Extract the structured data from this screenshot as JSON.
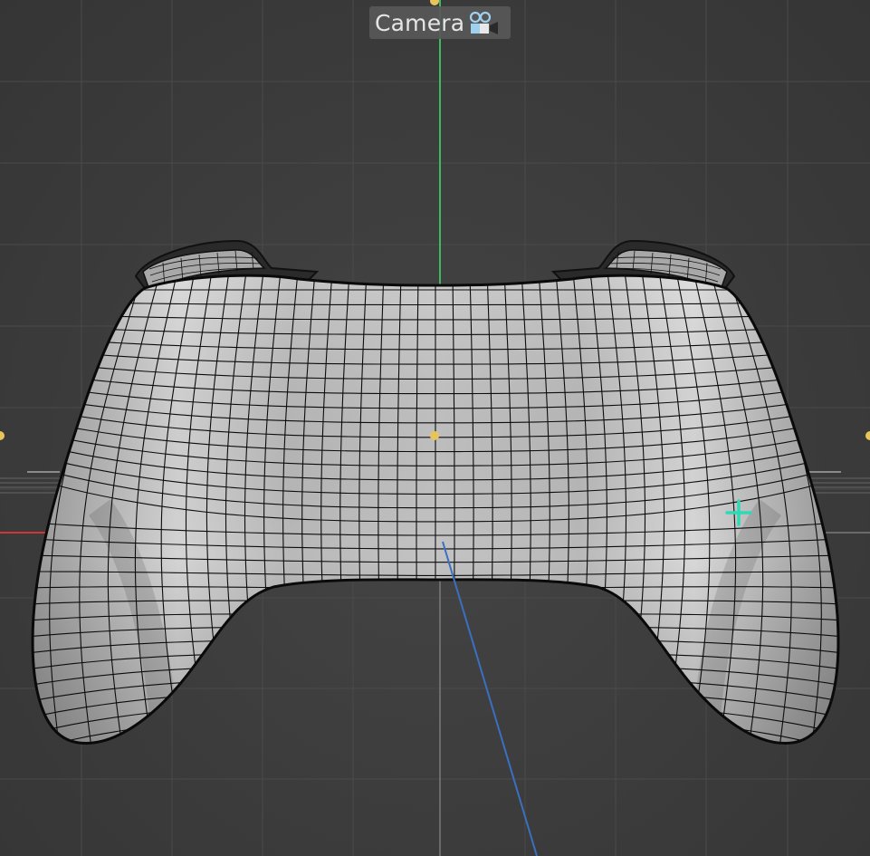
{
  "viewport": {
    "camera_label": "Camera",
    "camera_icon": "camera-icon",
    "object_name": "gamepad-mesh",
    "axis_colors": {
      "x": "#d0353a",
      "y": "#3fb862",
      "z": "#3b6fc2"
    },
    "accent_colors": {
      "handle": "#e8c55a",
      "cursor": "#2fd9b4",
      "background": "#3c3c3c"
    }
  }
}
